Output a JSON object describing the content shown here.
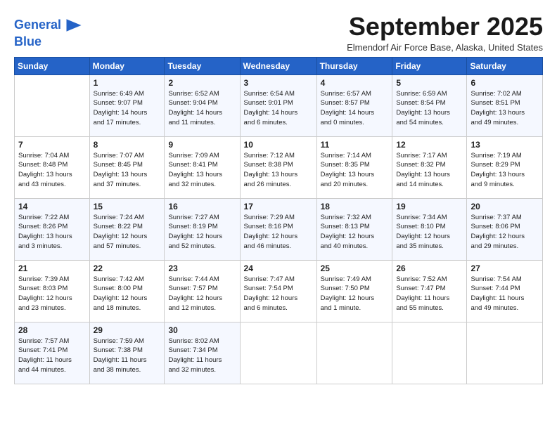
{
  "logo": {
    "line1": "General",
    "line2": "Blue"
  },
  "title": "September 2025",
  "location": "Elmendorf Air Force Base, Alaska, United States",
  "weekdays": [
    "Sunday",
    "Monday",
    "Tuesday",
    "Wednesday",
    "Thursday",
    "Friday",
    "Saturday"
  ],
  "weeks": [
    [
      {
        "day": "",
        "info": ""
      },
      {
        "day": "1",
        "info": "Sunrise: 6:49 AM\nSunset: 9:07 PM\nDaylight: 14 hours\nand 17 minutes."
      },
      {
        "day": "2",
        "info": "Sunrise: 6:52 AM\nSunset: 9:04 PM\nDaylight: 14 hours\nand 11 minutes."
      },
      {
        "day": "3",
        "info": "Sunrise: 6:54 AM\nSunset: 9:01 PM\nDaylight: 14 hours\nand 6 minutes."
      },
      {
        "day": "4",
        "info": "Sunrise: 6:57 AM\nSunset: 8:57 PM\nDaylight: 14 hours\nand 0 minutes."
      },
      {
        "day": "5",
        "info": "Sunrise: 6:59 AM\nSunset: 8:54 PM\nDaylight: 13 hours\nand 54 minutes."
      },
      {
        "day": "6",
        "info": "Sunrise: 7:02 AM\nSunset: 8:51 PM\nDaylight: 13 hours\nand 49 minutes."
      }
    ],
    [
      {
        "day": "7",
        "info": "Sunrise: 7:04 AM\nSunset: 8:48 PM\nDaylight: 13 hours\nand 43 minutes."
      },
      {
        "day": "8",
        "info": "Sunrise: 7:07 AM\nSunset: 8:45 PM\nDaylight: 13 hours\nand 37 minutes."
      },
      {
        "day": "9",
        "info": "Sunrise: 7:09 AM\nSunset: 8:41 PM\nDaylight: 13 hours\nand 32 minutes."
      },
      {
        "day": "10",
        "info": "Sunrise: 7:12 AM\nSunset: 8:38 PM\nDaylight: 13 hours\nand 26 minutes."
      },
      {
        "day": "11",
        "info": "Sunrise: 7:14 AM\nSunset: 8:35 PM\nDaylight: 13 hours\nand 20 minutes."
      },
      {
        "day": "12",
        "info": "Sunrise: 7:17 AM\nSunset: 8:32 PM\nDaylight: 13 hours\nand 14 minutes."
      },
      {
        "day": "13",
        "info": "Sunrise: 7:19 AM\nSunset: 8:29 PM\nDaylight: 13 hours\nand 9 minutes."
      }
    ],
    [
      {
        "day": "14",
        "info": "Sunrise: 7:22 AM\nSunset: 8:26 PM\nDaylight: 13 hours\nand 3 minutes."
      },
      {
        "day": "15",
        "info": "Sunrise: 7:24 AM\nSunset: 8:22 PM\nDaylight: 12 hours\nand 57 minutes."
      },
      {
        "day": "16",
        "info": "Sunrise: 7:27 AM\nSunset: 8:19 PM\nDaylight: 12 hours\nand 52 minutes."
      },
      {
        "day": "17",
        "info": "Sunrise: 7:29 AM\nSunset: 8:16 PM\nDaylight: 12 hours\nand 46 minutes."
      },
      {
        "day": "18",
        "info": "Sunrise: 7:32 AM\nSunset: 8:13 PM\nDaylight: 12 hours\nand 40 minutes."
      },
      {
        "day": "19",
        "info": "Sunrise: 7:34 AM\nSunset: 8:10 PM\nDaylight: 12 hours\nand 35 minutes."
      },
      {
        "day": "20",
        "info": "Sunrise: 7:37 AM\nSunset: 8:06 PM\nDaylight: 12 hours\nand 29 minutes."
      }
    ],
    [
      {
        "day": "21",
        "info": "Sunrise: 7:39 AM\nSunset: 8:03 PM\nDaylight: 12 hours\nand 23 minutes."
      },
      {
        "day": "22",
        "info": "Sunrise: 7:42 AM\nSunset: 8:00 PM\nDaylight: 12 hours\nand 18 minutes."
      },
      {
        "day": "23",
        "info": "Sunrise: 7:44 AM\nSunset: 7:57 PM\nDaylight: 12 hours\nand 12 minutes."
      },
      {
        "day": "24",
        "info": "Sunrise: 7:47 AM\nSunset: 7:54 PM\nDaylight: 12 hours\nand 6 minutes."
      },
      {
        "day": "25",
        "info": "Sunrise: 7:49 AM\nSunset: 7:50 PM\nDaylight: 12 hours\nand 1 minute."
      },
      {
        "day": "26",
        "info": "Sunrise: 7:52 AM\nSunset: 7:47 PM\nDaylight: 11 hours\nand 55 minutes."
      },
      {
        "day": "27",
        "info": "Sunrise: 7:54 AM\nSunset: 7:44 PM\nDaylight: 11 hours\nand 49 minutes."
      }
    ],
    [
      {
        "day": "28",
        "info": "Sunrise: 7:57 AM\nSunset: 7:41 PM\nDaylight: 11 hours\nand 44 minutes."
      },
      {
        "day": "29",
        "info": "Sunrise: 7:59 AM\nSunset: 7:38 PM\nDaylight: 11 hours\nand 38 minutes."
      },
      {
        "day": "30",
        "info": "Sunrise: 8:02 AM\nSunset: 7:34 PM\nDaylight: 11 hours\nand 32 minutes."
      },
      {
        "day": "",
        "info": ""
      },
      {
        "day": "",
        "info": ""
      },
      {
        "day": "",
        "info": ""
      },
      {
        "day": "",
        "info": ""
      }
    ]
  ]
}
